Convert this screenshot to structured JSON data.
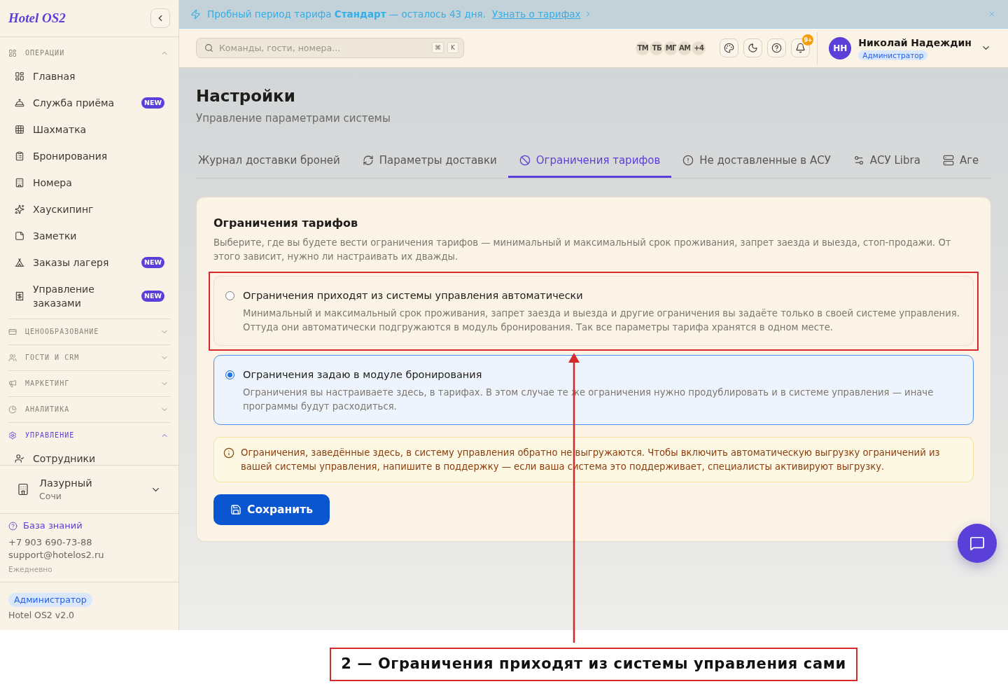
{
  "sidebar": {
    "logo": "Hotel OS2",
    "sections": [
      {
        "label": "ОПЕРАЦИИ",
        "expanded": true,
        "current": false,
        "items": [
          {
            "label": "Главная"
          },
          {
            "label": "Служба приёма",
            "badge": "NEW"
          },
          {
            "label": "Шахматка"
          },
          {
            "label": "Бронирования"
          },
          {
            "label": "Номера"
          },
          {
            "label": "Хаускипинг"
          },
          {
            "label": "Заметки"
          },
          {
            "label": "Заказы лагеря",
            "badge": "NEW"
          },
          {
            "label": "Управление заказами",
            "badge": "NEW"
          }
        ]
      },
      {
        "label": "ЦЕНООБРАЗОВАНИЕ",
        "expanded": false,
        "current": false
      },
      {
        "label": "ГОСТИ И CRM",
        "expanded": false,
        "current": false
      },
      {
        "label": "МАРКЕТИНГ",
        "expanded": false,
        "current": false
      },
      {
        "label": "АНАЛИТИКА",
        "expanded": false,
        "current": false
      },
      {
        "label": "УПРАВЛЕНИЕ",
        "expanded": true,
        "current": true,
        "items": [
          {
            "label": "Сотрудники"
          }
        ]
      }
    ],
    "hotel": {
      "name": "Лазурный",
      "city": "Сочи"
    },
    "support": {
      "knowledge_base": "База знаний",
      "phone": "+7 903 690-73-88",
      "email": "support@hotelos2.ru",
      "hours": "Ежедневно"
    },
    "footer": {
      "role": "Администратор",
      "version": "Hotel OS2 v2.0"
    }
  },
  "banner": {
    "text": "Пробный период тарифа **Стандарт** — осталось 43 дня.",
    "link": "Узнать о тарифах"
  },
  "topbar": {
    "search": {
      "placeholder": "Команды, гости, номера...",
      "shortcut": [
        "⌘",
        "K"
      ]
    },
    "presence": [
      "ТМ",
      "ТБ",
      "МГ",
      "АМ"
    ],
    "presence_more": "+4",
    "notifications": "9+",
    "user": {
      "initials": "НН",
      "name": "Николай Надеждин",
      "role": "Администратор"
    }
  },
  "page": {
    "title": "Настройки",
    "subtitle": "Управление параметрами системы"
  },
  "tabs": [
    {
      "label": "Журнал доставки броней",
      "selected": false
    },
    {
      "label": "Параметры доставки",
      "selected": false
    },
    {
      "label": "Ограничения тарифов",
      "selected": true
    },
    {
      "label": "Не доставленные в АСУ",
      "selected": false
    },
    {
      "label": "АСУ Libra",
      "selected": false
    },
    {
      "label": "Аге",
      "selected": false
    }
  ],
  "card": {
    "title": "Ограничения тарифов",
    "description": "Выберите, где вы будете вести ограничения тарифов — минимальный и максимальный срок проживания, запрет заезда и выезда, стоп-продажи. От этого зависит, нужно ли настраивать их дважды.",
    "options": [
      {
        "title": "Ограничения приходят из системы управления автоматически",
        "description": "Минимальный и максимальный срок проживания, запрет заезда и выезда и другие ограничения вы задаёте только в своей системе управления. Оттуда они автоматически подгружаются в модуль бронирования. Так все параметры тарифа хранятся в одном месте.",
        "selected": false,
        "highlighted": true
      },
      {
        "title": "Ограничения задаю в модуле бронирования",
        "description": "Ограничения вы настраиваете здесь, в тарифах. В этом случае те же ограничения нужно продублировать и в системе управления — иначе программы будут расходиться.",
        "selected": true,
        "highlighted": false
      }
    ],
    "notice": "Ограничения, заведённые здесь, в систему управления обратно не выгружаются. Чтобы включить автоматическую выгрузку ограничений из вашей системы управления, напишите в поддержку — если ваша система это поддерживает, специалисты активируют выгрузку.",
    "save_button": "Сохранить"
  },
  "annotation": {
    "callout": "2 — Ограничения приходят из системы управления сами",
    "arrow": true
  }
}
